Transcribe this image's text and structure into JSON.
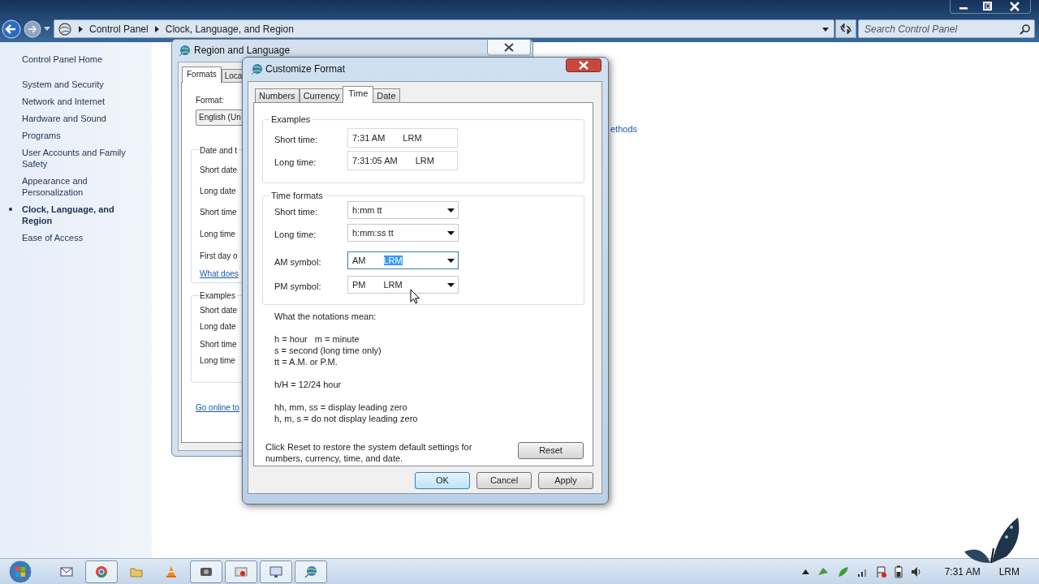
{
  "explorer": {
    "breadcrumb": [
      "Control Panel",
      "Clock, Language, and Region"
    ],
    "search": {
      "placeholder": "Search Control Panel"
    },
    "sidebar": {
      "items": [
        {
          "label": "Control Panel Home",
          "selected": false
        },
        {
          "label": "System and Security",
          "selected": false
        },
        {
          "label": "Network and Internet",
          "selected": false
        },
        {
          "label": "Hardware and Sound",
          "selected": false
        },
        {
          "label": "Programs",
          "selected": false
        },
        {
          "label": "User Accounts and Family Safety",
          "selected": false
        },
        {
          "label": "Appearance and Personalization",
          "selected": false
        },
        {
          "label": "Clock, Language, and Region",
          "selected": true
        },
        {
          "label": "Ease of Access",
          "selected": false
        }
      ]
    },
    "content_link": "ethods"
  },
  "region_dialog": {
    "title": "Region and Language",
    "tabs": [
      {
        "label": "Formats",
        "selected": true
      },
      {
        "label": "Loca",
        "selected": false
      }
    ],
    "format_label": "Format:",
    "format_value": "English (Un",
    "date_group": {
      "title": "Date and t",
      "labels": [
        "Short date",
        "Long date",
        "Short time",
        "Long time",
        "First day o"
      ]
    },
    "help_link": "What does",
    "examples_group": {
      "title": "Examples",
      "labels": [
        "Short date",
        "Long date",
        "Short time",
        "Long time"
      ]
    },
    "online_link": "Go online to"
  },
  "customize_dialog": {
    "title": "Customize Format",
    "tabs": [
      {
        "label": "Numbers",
        "selected": false
      },
      {
        "label": "Currency",
        "selected": false
      },
      {
        "label": "Time",
        "selected": true
      },
      {
        "label": "Date",
        "selected": false
      }
    ],
    "examples": {
      "title": "Examples",
      "rows": [
        {
          "label": "Short time:",
          "parts": [
            {
              "text": "7:31 AM",
              "selected": false
            },
            {
              "text": "LRM",
              "selected": false
            }
          ]
        },
        {
          "label": "Long time:",
          "parts": [
            {
              "text": "7:31:05 AM",
              "selected": false
            },
            {
              "text": "LRM",
              "selected": false
            }
          ]
        }
      ]
    },
    "formats": {
      "title": "Time formats",
      "rows": [
        {
          "label": "Short time:",
          "parts": [
            {
              "text": "h:mm tt",
              "selected": false
            }
          ],
          "focused": false
        },
        {
          "label": "Long time:",
          "parts": [
            {
              "text": "h:mm:ss tt",
              "selected": false
            }
          ],
          "focused": false
        },
        {
          "label": "AM symbol:",
          "parts": [
            {
              "text": "AM",
              "selected": false
            },
            {
              "text": "LRM",
              "selected": true
            }
          ],
          "focused": true
        },
        {
          "label": "PM symbol:",
          "parts": [
            {
              "text": "PM",
              "selected": false
            },
            {
              "text": "LRM",
              "selected": false
            }
          ],
          "focused": false
        }
      ]
    },
    "notations": {
      "heading": "What the notations mean:",
      "paragraphs": [
        [
          "h = hour   m = minute",
          "s = second (long time only)",
          "tt = A.M. or P.M."
        ],
        [
          "h/H = 12/24 hour"
        ],
        [
          "hh, mm, ss = display leading zero",
          "h, m, s = do not display leading zero"
        ]
      ]
    },
    "reset_text": "Click Reset to restore the system default settings for numbers, currency, time, and date.",
    "reset_button": "Reset",
    "buttons": [
      {
        "label": "OK",
        "default": true
      },
      {
        "label": "Cancel",
        "default": false
      },
      {
        "label": "Apply",
        "default": false
      }
    ]
  },
  "taskbar": {
    "items": [
      {
        "kind": "mail",
        "running": false
      },
      {
        "kind": "browser",
        "running": true
      },
      {
        "kind": "folder",
        "running": false
      },
      {
        "kind": "cone",
        "running": false
      },
      {
        "kind": "media",
        "running": true
      },
      {
        "kind": "record",
        "running": true
      },
      {
        "kind": "screen",
        "running": true
      },
      {
        "kind": "globe",
        "running": true
      }
    ],
    "clock": "7:31 AM",
    "language": "LRM"
  }
}
